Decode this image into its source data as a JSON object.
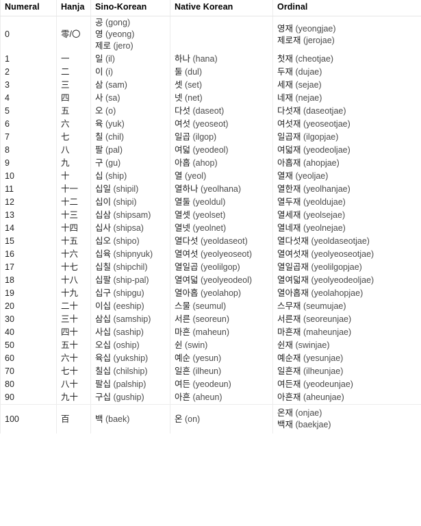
{
  "table": {
    "headers": [
      "Numeral",
      "Hanja",
      "Sino-Korean",
      "Native Korean",
      "Ordinal"
    ],
    "rows": [
      {
        "numeral": "0",
        "hanja": "零/〇",
        "sino": [
          "공 (gong)",
          "영 (yeong)",
          "제로 (jero)"
        ],
        "native": [
          ""
        ],
        "ordinal": [
          "영재 (yeongjae)",
          "제로재 (jerojae)"
        ]
      },
      {
        "numeral": "1",
        "hanja": "一",
        "sino": [
          "일 (il)"
        ],
        "native": [
          "하나 (hana)"
        ],
        "ordinal": [
          "첫재 (cheotjae)"
        ]
      },
      {
        "numeral": "2",
        "hanja": "二",
        "sino": [
          "이 (i)"
        ],
        "native": [
          "둘 (dul)"
        ],
        "ordinal": [
          "두재 (dujae)"
        ]
      },
      {
        "numeral": "3",
        "hanja": "三",
        "sino": [
          "삼 (sam)"
        ],
        "native": [
          "셋 (set)"
        ],
        "ordinal": [
          "세재 (sejae)"
        ]
      },
      {
        "numeral": "4",
        "hanja": "四",
        "sino": [
          "사 (sa)"
        ],
        "native": [
          "넷 (net)"
        ],
        "ordinal": [
          "네재 (nejae)"
        ]
      },
      {
        "numeral": "5",
        "hanja": "五",
        "sino": [
          "오 (o)"
        ],
        "native": [
          "다섯 (daseot)"
        ],
        "ordinal": [
          "다섯재 (daseotjae)"
        ]
      },
      {
        "numeral": "6",
        "hanja": "六",
        "sino": [
          "육 (yuk)"
        ],
        "native": [
          "여섯 (yeoseot)"
        ],
        "ordinal": [
          "여섯재 (yeoseotjae)"
        ]
      },
      {
        "numeral": "7",
        "hanja": "七",
        "sino": [
          "칠 (chil)"
        ],
        "native": [
          "일곱 (ilgop)"
        ],
        "ordinal": [
          "일곱재 (ilgopjae)"
        ]
      },
      {
        "numeral": "8",
        "hanja": "八",
        "sino": [
          "팔 (pal)"
        ],
        "native": [
          "여덟 (yeodeol)"
        ],
        "ordinal": [
          "여덟재 (yeodeoljae)"
        ]
      },
      {
        "numeral": "9",
        "hanja": "九",
        "sino": [
          "구 (gu)"
        ],
        "native": [
          "아홉 (ahop)"
        ],
        "ordinal": [
          "아홉재 (ahopjae)"
        ]
      },
      {
        "numeral": "10",
        "hanja": "十",
        "sino": [
          "십 (ship)"
        ],
        "native": [
          "열 (yeol)"
        ],
        "ordinal": [
          "열재 (yeoljae)"
        ]
      },
      {
        "numeral": "11",
        "hanja": "十一",
        "sino": [
          "십일 (shipil)"
        ],
        "native": [
          "열하나 (yeolhana)"
        ],
        "ordinal": [
          "열한재 (yeolhanjae)"
        ]
      },
      {
        "numeral": "12",
        "hanja": "十二",
        "sino": [
          "십이 (shipi)"
        ],
        "native": [
          "열둘 (yeoldul)"
        ],
        "ordinal": [
          "열두재 (yeoldujae)"
        ]
      },
      {
        "numeral": "13",
        "hanja": "十三",
        "sino": [
          "십삼 (shipsam)"
        ],
        "native": [
          "열셋 (yeolset)"
        ],
        "ordinal": [
          "열세재 (yeolsejae)"
        ]
      },
      {
        "numeral": "14",
        "hanja": "十四",
        "sino": [
          "십사 (shipsa)"
        ],
        "native": [
          "열넷 (yeolnet)"
        ],
        "ordinal": [
          "열네재 (yeolnejae)"
        ]
      },
      {
        "numeral": "15",
        "hanja": "十五",
        "sino": [
          "십오 (shipo)"
        ],
        "native": [
          "열다섯 (yeoldaseot)"
        ],
        "ordinal": [
          "열다섯재 (yeoldaseotjae)"
        ]
      },
      {
        "numeral": "16",
        "hanja": "十六",
        "sino": [
          "십육 (shipnyuk)"
        ],
        "native": [
          "열여섯 (yeolyeoseot)"
        ],
        "ordinal": [
          "열여섯재 (yeolyeoseotjae)"
        ]
      },
      {
        "numeral": "17",
        "hanja": "十七",
        "sino": [
          "십칠 (shipchil)"
        ],
        "native": [
          "열일곱 (yeolilgop)"
        ],
        "ordinal": [
          "열일곱재 (yeolilgopjae)"
        ]
      },
      {
        "numeral": "18",
        "hanja": "十八",
        "sino": [
          "십팔 (ship-pal)"
        ],
        "native": [
          "열여덟 (yeolyeodeol)"
        ],
        "ordinal": [
          "열여덟재 (yeolyeodeoljae)"
        ]
      },
      {
        "numeral": "19",
        "hanja": "十九",
        "sino": [
          "십구 (shipgu)"
        ],
        "native": [
          "열아홉 (yeolahop)"
        ],
        "ordinal": [
          "열아홉재 (yeolahopjae)"
        ]
      },
      {
        "numeral": "20",
        "hanja": "二十",
        "sino": [
          "이십 (eeship)"
        ],
        "native": [
          "스물 (seumul)"
        ],
        "ordinal": [
          "스무재 (seumujae)"
        ]
      },
      {
        "numeral": "30",
        "hanja": "三十",
        "sino": [
          "삼십 (samship)"
        ],
        "native": [
          "서른 (seoreun)"
        ],
        "ordinal": [
          "서른재 (seoreunjae)"
        ]
      },
      {
        "numeral": "40",
        "hanja": "四十",
        "sino": [
          "사십 (saship)"
        ],
        "native": [
          "마흔 (maheun)"
        ],
        "ordinal": [
          "마흔재 (maheunjae)"
        ]
      },
      {
        "numeral": "50",
        "hanja": "五十",
        "sino": [
          "오십 (oship)"
        ],
        "native": [
          "쉰 (swin)"
        ],
        "ordinal": [
          "쉰재 (swinjae)"
        ]
      },
      {
        "numeral": "60",
        "hanja": "六十",
        "sino": [
          "육십 (yukship)"
        ],
        "native": [
          "예순 (yesun)"
        ],
        "ordinal": [
          "예순재 (yesunjae)"
        ]
      },
      {
        "numeral": "70",
        "hanja": "七十",
        "sino": [
          "칠십 (chilship)"
        ],
        "native": [
          "일흔 (ilheun)"
        ],
        "ordinal": [
          "일흔재 (ilheunjae)"
        ]
      },
      {
        "numeral": "80",
        "hanja": "八十",
        "sino": [
          "팔십 (palship)"
        ],
        "native": [
          "여든 (yeodeun)"
        ],
        "ordinal": [
          "여든재 (yeodeunjae)"
        ]
      },
      {
        "numeral": "90",
        "hanja": "九十",
        "sino": [
          "구십 (guship)"
        ],
        "native": [
          "아흔 (aheun)"
        ],
        "ordinal": [
          "아흔재 (aheunjae)"
        ]
      },
      {
        "numeral": "100",
        "hanja": "百",
        "sino": [
          "백 (baek)"
        ],
        "native": [
          "온 (on)"
        ],
        "ordinal": [
          "온재 (onjae)",
          "백재 (baekjae)"
        ]
      }
    ]
  },
  "colors": {
    "text": "#1f1f1f",
    "header_text": "#000000",
    "rule": "#ececec",
    "background": "#ffffff"
  }
}
